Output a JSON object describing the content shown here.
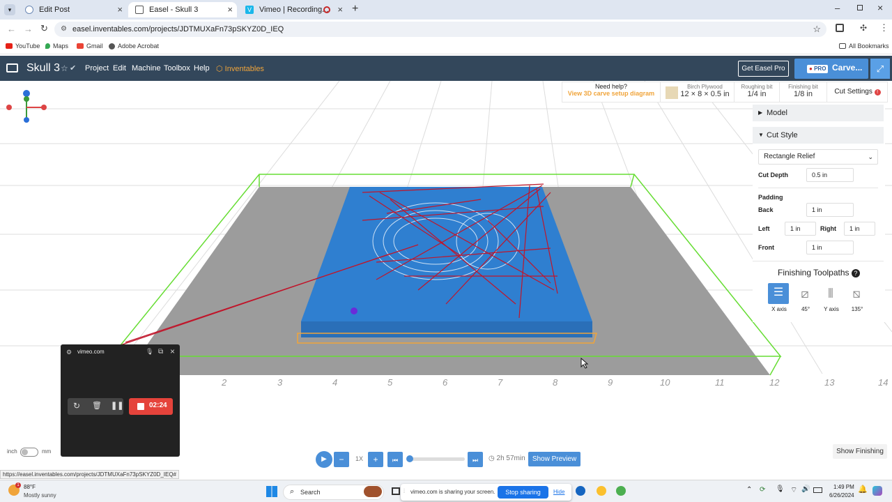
{
  "browser": {
    "tabs": [
      {
        "label": "Edit Post"
      },
      {
        "label": "Easel - Skull 3"
      },
      {
        "label": "Vimeo | Recording..."
      }
    ],
    "url": "easel.inventables.com/projects/JDTMUXaFn73pSKYZ0D_IEQ",
    "bookmarks": [
      "YouTube",
      "Maps",
      "Gmail",
      "Adobe Acrobat"
    ],
    "all_bookmarks": "All Bookmarks"
  },
  "app": {
    "title": "Skull 3",
    "menu": [
      "Project",
      "Edit",
      "Machine",
      "Toolbox",
      "Help"
    ],
    "brand": "Inventables",
    "get_pro": "Get Easel Pro",
    "pro_badge": "PRO",
    "carve": "Carve..."
  },
  "helpbar": {
    "need_help": "Need help?",
    "view_diagram": "View 3D carve setup diagram",
    "material_label": "Birch Plywood",
    "material_size": "12 × 8 × 0.5 in",
    "roughing_label": "Roughing bit",
    "roughing_value": "1/4 in",
    "finishing_label": "Finishing bit",
    "finishing_value": "1/8 in",
    "cut_settings": "Cut Settings"
  },
  "panel": {
    "model": "Model",
    "cut_style": "Cut Style",
    "style_select": "Rectangle Relief",
    "cut_depth_label": "Cut Depth",
    "cut_depth_value": "0.5 in",
    "padding_label": "Padding",
    "back_label": "Back",
    "back_value": "1 in",
    "left_label": "Left",
    "left_value": "1 in",
    "right_label": "Right",
    "right_value": "1 in",
    "front_label": "Front",
    "front_value": "1 in",
    "finishing_toolpaths": "Finishing Toolpaths",
    "toolpaths": [
      "X axis",
      "45°",
      "Y axis",
      "135°"
    ]
  },
  "ruler": [
    "2",
    "3",
    "4",
    "5",
    "6",
    "7",
    "8",
    "9",
    "10",
    "11",
    "12",
    "13",
    "14"
  ],
  "controls": {
    "unit_inch": "inch",
    "unit_mm": "mm",
    "speed": "1X",
    "time": "2h 57min",
    "show_preview": "Show Preview",
    "show_finishing": "Show Finishing",
    "progress": 0.0
  },
  "vimeo": {
    "title": "vimeo.com",
    "timer": "02:24"
  },
  "status_url": "https://easel.inventables.com/projects/JDTMUXaFn73pSKYZ0D_IEQ#",
  "taskbar": {
    "weather_temp": "88°F",
    "weather_desc": "Mostly sunny",
    "search": "Search",
    "sharing_text": "vimeo.com is sharing your screen.",
    "stop_sharing": "Stop sharing",
    "hide": "Hide",
    "time": "1:49 PM",
    "date": "6/26/2024"
  },
  "colors": {
    "header": "#33475b",
    "accent": "#4a8fd8",
    "orange": "#f0a43a",
    "stock": "#2f7fd0",
    "toolpath": "#c0152a"
  }
}
